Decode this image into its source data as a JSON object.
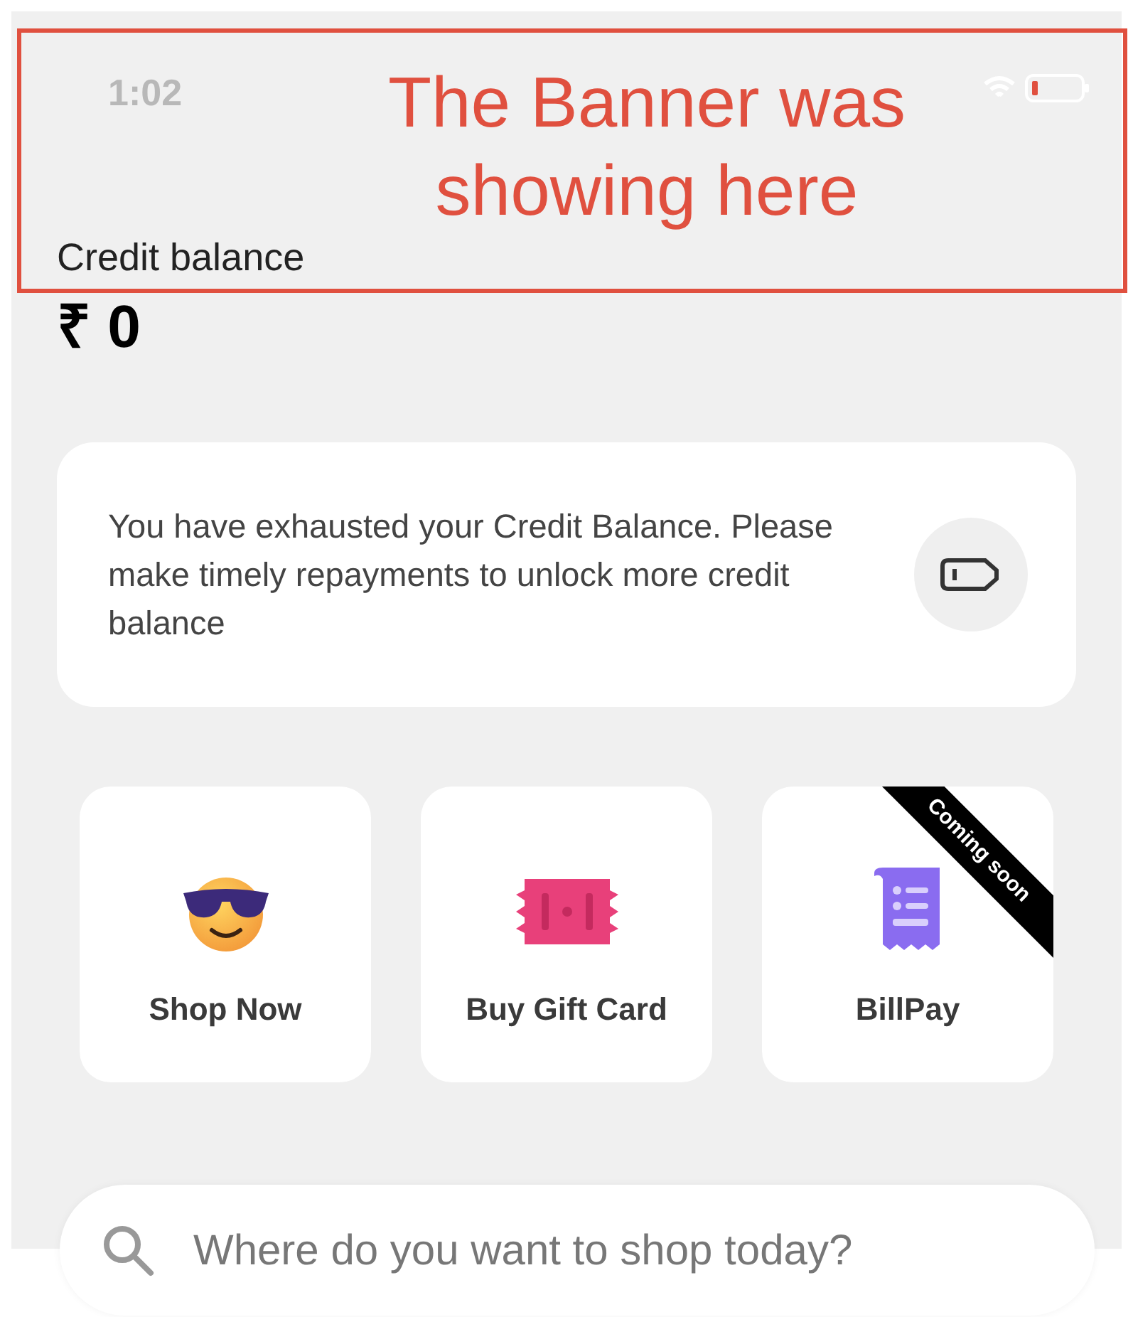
{
  "status_bar": {
    "time": "1:02"
  },
  "annotation": {
    "text": "The Banner was showing here",
    "color": "#e0503f"
  },
  "balance": {
    "label": "Credit balance",
    "amount": "₹ 0"
  },
  "notice": {
    "text": "You have exhausted your Credit Balance. Please make timely repayments to unlock more credit balance"
  },
  "actions": [
    {
      "label": "Shop Now",
      "kind": "emoji"
    },
    {
      "label": "Buy Gift Card",
      "kind": "ticket"
    },
    {
      "label": "BillPay",
      "kind": "receipt",
      "ribbon": "Coming soon"
    }
  ],
  "search": {
    "placeholder": "Where do you want to shop today?"
  }
}
